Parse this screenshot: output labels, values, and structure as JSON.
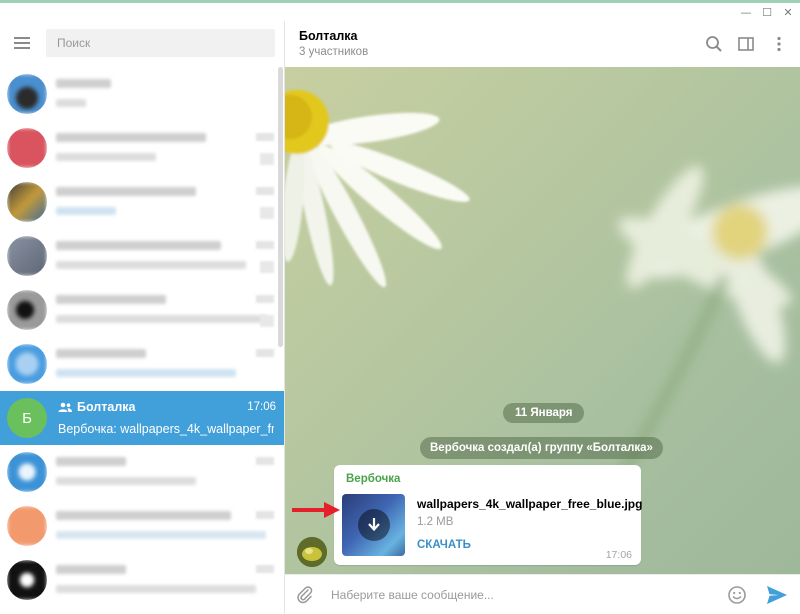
{
  "window": {
    "minimize_glyph": "—",
    "maximize_glyph": "☐",
    "close_glyph": "✕"
  },
  "sidebar": {
    "search_placeholder": "Поиск",
    "active_chat": {
      "avatar_letter": "Б",
      "name": "Болталка",
      "time": "17:06",
      "preview": "Вербочка: wallpapers_4k_wallpaper_free..."
    }
  },
  "chat": {
    "title": "Болталка",
    "subtitle": "3 участников",
    "date_divider": "11 Января",
    "service_message": "Вербочка создал(а) группу «Болталка»",
    "message": {
      "sender": "Вербочка",
      "file_name": "wallpapers_4k_wallpaper_free_blue.jpg",
      "file_size": "1.2 MB",
      "action_label": "СКАЧАТЬ",
      "time": "17:06"
    }
  },
  "composer": {
    "placeholder": "Наберите ваше сообщение..."
  },
  "colors": {
    "accent": "#419fd9",
    "sender_name": "#4aa34a",
    "avatar_group": "#6bc05e",
    "arrow": "#e4202a"
  },
  "icons": [
    "menu-icon",
    "search-icon",
    "sidebar-toggle-icon",
    "more-vertical-icon",
    "group-icon",
    "download-icon",
    "paperclip-icon",
    "emoji-icon",
    "send-icon",
    "arrow-pointer-icon"
  ]
}
